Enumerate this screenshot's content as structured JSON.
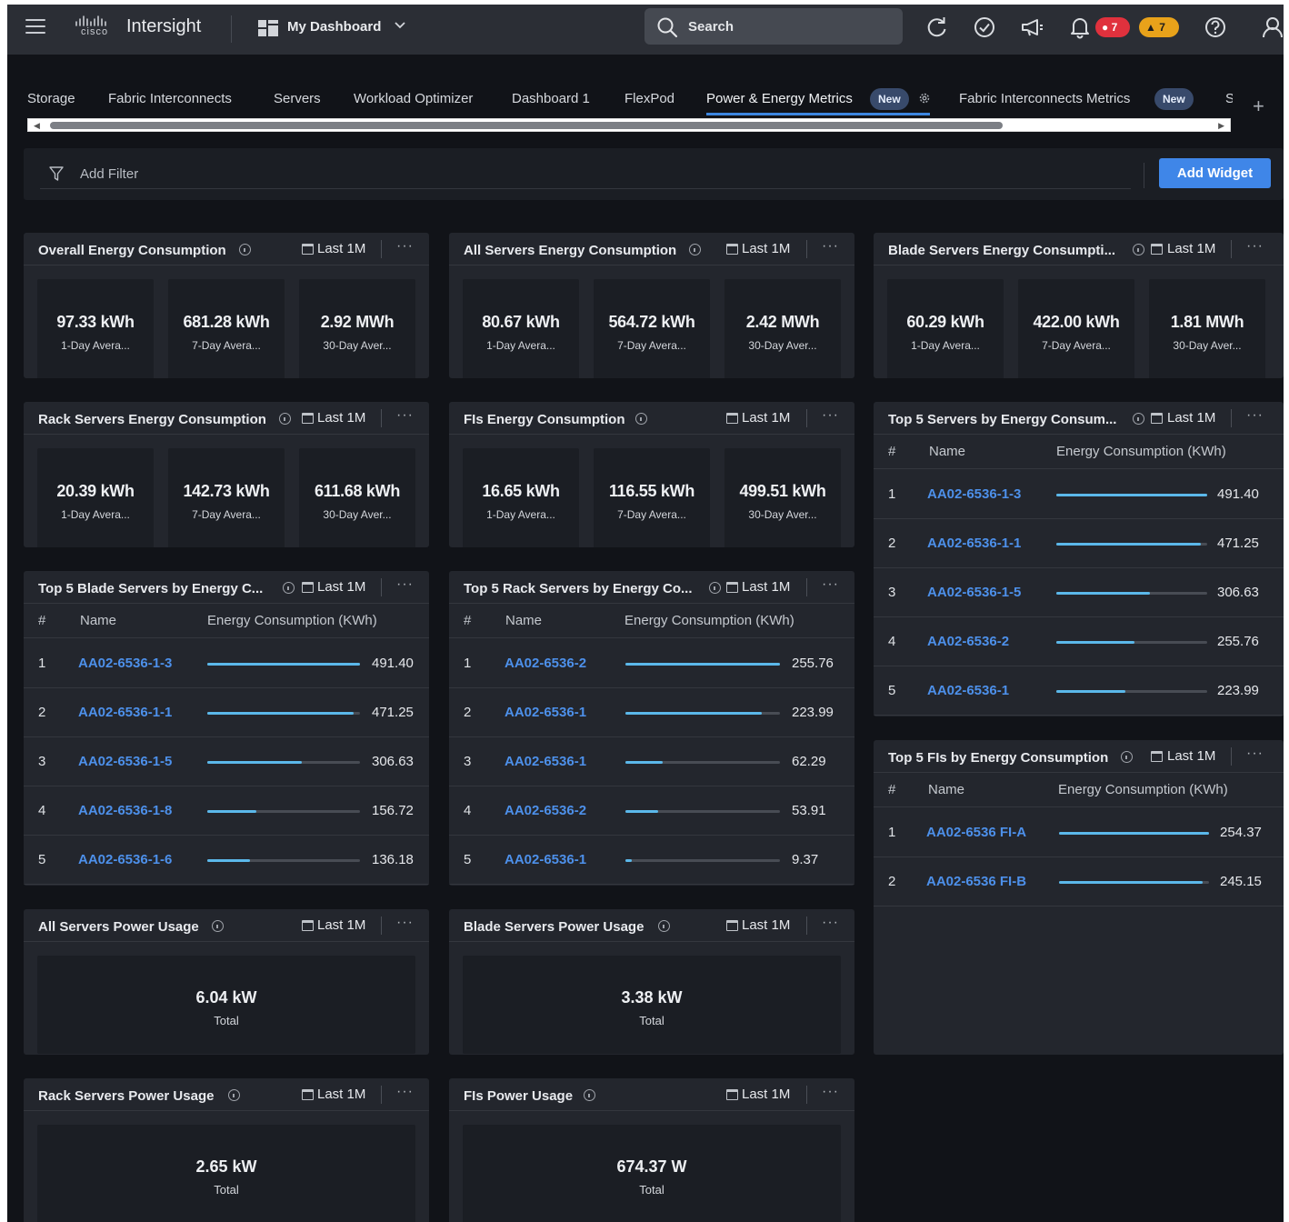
{
  "topbar": {
    "brand": "cisco",
    "app_name": "Intersight",
    "dashboard_selector": "My Dashboard",
    "search_placeholder": "Search",
    "critical_alarms": "7",
    "warning_alarms": "7"
  },
  "tabs": [
    {
      "label": "Storage"
    },
    {
      "label": "Fabric Interconnects"
    },
    {
      "label": "Servers"
    },
    {
      "label": "Workload Optimizer"
    },
    {
      "label": "Dashboard 1"
    },
    {
      "label": "FlexPod"
    },
    {
      "label": "Power & Energy Metrics",
      "badge": "New",
      "active": true
    },
    {
      "label": "Fabric Interconnects Metrics",
      "badge": "New"
    },
    {
      "label": "S"
    }
  ],
  "filter": {
    "placeholder": "Add Filter",
    "add_widget": "Add Widget"
  },
  "colors": {
    "accent": "#3f86e8",
    "link": "#4d90ea",
    "bar": "#5bb8ea",
    "critical": "#e0313d",
    "warning": "#e8a21a"
  },
  "widgets": {
    "overall_energy": {
      "title": "Overall Energy Consumption",
      "range": "Last 1M",
      "stats": [
        {
          "value": "97.33 kWh",
          "label": "1-Day Avera..."
        },
        {
          "value": "681.28 kWh",
          "label": "7-Day Avera..."
        },
        {
          "value": "2.92 MWh",
          "label": "30-Day Aver..."
        }
      ]
    },
    "all_servers_energy": {
      "title": "All Servers Energy Consumption",
      "range": "Last 1M",
      "stats": [
        {
          "value": "80.67 kWh",
          "label": "1-Day Avera..."
        },
        {
          "value": "564.72 kWh",
          "label": "7-Day Avera..."
        },
        {
          "value": "2.42 MWh",
          "label": "30-Day Aver..."
        }
      ]
    },
    "blade_servers_energy": {
      "title": "Blade Servers Energy Consumpti...",
      "range": "Last 1M",
      "stats": [
        {
          "value": "60.29 kWh",
          "label": "1-Day Avera..."
        },
        {
          "value": "422.00 kWh",
          "label": "7-Day Avera..."
        },
        {
          "value": "1.81 MWh",
          "label": "30-Day Aver..."
        }
      ]
    },
    "rack_servers_energy": {
      "title": "Rack Servers Energy Consumption",
      "range": "Last 1M",
      "stats": [
        {
          "value": "20.39 kWh",
          "label": "1-Day Avera..."
        },
        {
          "value": "142.73 kWh",
          "label": "7-Day Avera..."
        },
        {
          "value": "611.68 kWh",
          "label": "30-Day Aver..."
        }
      ]
    },
    "fis_energy": {
      "title": "FIs Energy Consumption",
      "range": "Last 1M",
      "stats": [
        {
          "value": "16.65 kWh",
          "label": "1-Day Avera..."
        },
        {
          "value": "116.55 kWh",
          "label": "7-Day Avera..."
        },
        {
          "value": "499.51 kWh",
          "label": "30-Day Aver..."
        }
      ]
    },
    "top5_servers": {
      "title": "Top 5 Servers by Energy Consum...",
      "range": "Last 1M",
      "columns": [
        "#",
        "Name",
        "Energy Consumption (KWh)"
      ],
      "rows": [
        {
          "idx": "1",
          "name": "AA02-6536-1-3",
          "value": "491.40",
          "fraction": 1.0
        },
        {
          "idx": "2",
          "name": "AA02-6536-1-1",
          "value": "471.25",
          "fraction": 0.96
        },
        {
          "idx": "3",
          "name": "AA02-6536-1-5",
          "value": "306.63",
          "fraction": 0.62
        },
        {
          "idx": "4",
          "name": "AA02-6536-2",
          "value": "255.76",
          "fraction": 0.52
        },
        {
          "idx": "5",
          "name": "AA02-6536-1",
          "value": "223.99",
          "fraction": 0.46
        }
      ]
    },
    "top5_blade": {
      "title": "Top 5 Blade Servers by Energy C...",
      "range": "Last 1M",
      "columns": [
        "#",
        "Name",
        "Energy Consumption (KWh)"
      ],
      "rows": [
        {
          "idx": "1",
          "name": "AA02-6536-1-3",
          "value": "491.40",
          "fraction": 1.0
        },
        {
          "idx": "2",
          "name": "AA02-6536-1-1",
          "value": "471.25",
          "fraction": 0.96
        },
        {
          "idx": "3",
          "name": "AA02-6536-1-5",
          "value": "306.63",
          "fraction": 0.62
        },
        {
          "idx": "4",
          "name": "AA02-6536-1-8",
          "value": "156.72",
          "fraction": 0.32
        },
        {
          "idx": "5",
          "name": "AA02-6536-1-6",
          "value": "136.18",
          "fraction": 0.28
        }
      ]
    },
    "top5_rack": {
      "title": "Top 5 Rack Servers by Energy Co...",
      "range": "Last 1M",
      "columns": [
        "#",
        "Name",
        "Energy Consumption (KWh)"
      ],
      "rows": [
        {
          "idx": "1",
          "name": "AA02-6536-2",
          "value": "255.76",
          "fraction": 1.0
        },
        {
          "idx": "2",
          "name": "AA02-6536-1",
          "value": "223.99",
          "fraction": 0.88
        },
        {
          "idx": "3",
          "name": "AA02-6536-1",
          "value": "62.29",
          "fraction": 0.24
        },
        {
          "idx": "4",
          "name": "AA02-6536-2",
          "value": "53.91",
          "fraction": 0.21
        },
        {
          "idx": "5",
          "name": "AA02-6536-1",
          "value": "9.37",
          "fraction": 0.04
        }
      ]
    },
    "top5_fis": {
      "title": "Top 5 FIs by Energy Consumption",
      "range": "Last 1M",
      "columns": [
        "#",
        "Name",
        "Energy Consumption (KWh)"
      ],
      "rows": [
        {
          "idx": "1",
          "name": "AA02-6536 FI-A",
          "value": "254.37",
          "fraction": 1.0
        },
        {
          "idx": "2",
          "name": "AA02-6536 FI-B",
          "value": "245.15",
          "fraction": 0.96
        }
      ]
    },
    "all_servers_power": {
      "title": "All Servers Power Usage",
      "range": "Last 1M",
      "value": "6.04 kW",
      "label": "Total"
    },
    "blade_servers_power": {
      "title": "Blade Servers Power Usage",
      "range": "Last 1M",
      "value": "3.38 kW",
      "label": "Total"
    },
    "rack_servers_power": {
      "title": "Rack Servers Power Usage",
      "range": "Last 1M",
      "value": "2.65 kW",
      "label": "Total"
    },
    "fis_power": {
      "title": "FIs Power Usage",
      "range": "Last 1M",
      "value": "674.37 W",
      "label": "Total"
    }
  }
}
